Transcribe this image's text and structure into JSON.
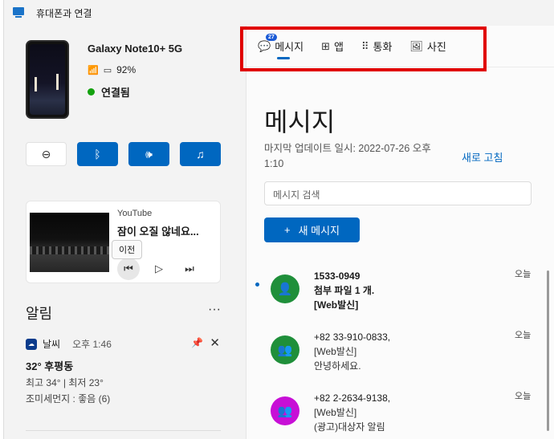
{
  "window": {
    "title": "휴대폰과 연결"
  },
  "device": {
    "name": "Galaxy Note10+ 5G",
    "battery": "92%",
    "status": "연결됨"
  },
  "media": {
    "source": "YouTube",
    "title": "잠이 오질 않네요...",
    "tooltip": "이전"
  },
  "notifications": {
    "heading": "알림",
    "more": "···",
    "item": {
      "app": "날씨",
      "time": "오후 1:46",
      "title": "32° 후평동",
      "line1": "최고 34° | 최저 23°",
      "line2": "조미세먼지 : 좋음 (6)"
    }
  },
  "tabs": [
    {
      "label": "메시지",
      "badge": "27",
      "icon": "chat-icon"
    },
    {
      "label": "앱",
      "icon": "apps-icon"
    },
    {
      "label": "통화",
      "icon": "dialpad-icon"
    },
    {
      "label": "사진",
      "icon": "photo-icon"
    }
  ],
  "messages_pane": {
    "title": "메시지",
    "updated": "마지막 업데이트 일시: 2022-07-26 오후 1:10",
    "refresh": "새로 고침",
    "search_placeholder": "메시지 검색",
    "new_message": "새 메시지"
  },
  "conversations": [
    {
      "from": "1533-0949",
      "line1": "첨부 파일 1 개.",
      "line2": "[Web발신]",
      "when": "오늘",
      "unread": true,
      "color": "#1f8f3a"
    },
    {
      "from": "+82 33-910-0833,",
      "line1": "[Web발신]",
      "line2": "안녕하세요.",
      "when": "오늘",
      "unread": false,
      "color": "#1f8f3a"
    },
    {
      "from": "+82 2-2634-9138,",
      "line1": "[Web발신]",
      "line2": "(광고)대상자 알림",
      "when": "오늘",
      "unread": false,
      "color": "#c70fd6"
    }
  ]
}
